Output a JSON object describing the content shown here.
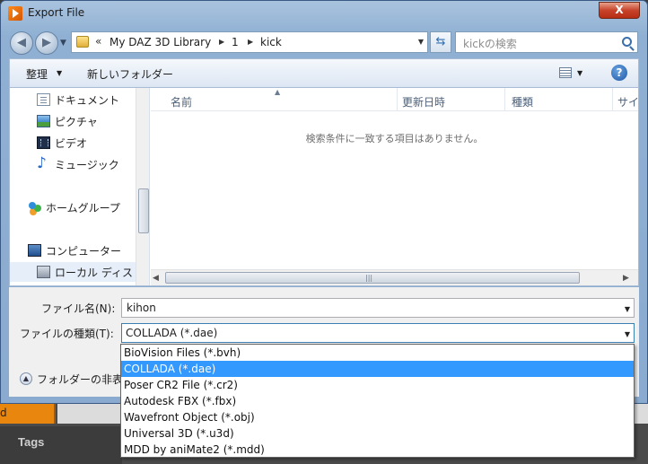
{
  "window": {
    "title": "Export File",
    "close_label": "X"
  },
  "address": {
    "chevrons": "«",
    "breadcrumbs": [
      "My DAZ 3D Library",
      "1",
      "kick"
    ]
  },
  "search": {
    "placeholder": "kickの検索"
  },
  "toolbar": {
    "organize": "整理",
    "new_folder": "新しいフォルダー"
  },
  "nav_pane": {
    "items": [
      {
        "label": "ドキュメント",
        "icon": "document-icon"
      },
      {
        "label": "ピクチャ",
        "icon": "pictures-icon"
      },
      {
        "label": "ビデオ",
        "icon": "video-icon"
      },
      {
        "label": "ミュージック",
        "icon": "music-icon"
      },
      {
        "label": "ホームグループ",
        "icon": "homegroup-icon"
      },
      {
        "label": "コンピューター",
        "icon": "computer-icon"
      },
      {
        "label": "ローカル ディス",
        "icon": "local-disk-icon"
      }
    ]
  },
  "file_list": {
    "columns": [
      "名前",
      "更新日時",
      "種類",
      "サイ"
    ],
    "empty_message": "検索条件に一致する項目はありません。"
  },
  "form": {
    "filename_label": "ファイル名(N):",
    "filename_value": "kihon",
    "filetype_label": "ファイルの種類(T):",
    "filetype_value": "COLLADA (*.dae)",
    "hide_folders_label": "フォルダーの非表"
  },
  "filetype_options": [
    "BioVision Files (*.bvh)",
    "COLLADA (*.dae)",
    "Poser CR2 File (*.cr2)",
    "Autodesk FBX (*.fbx)",
    "Wavefront Object (*.obj)",
    "Universal 3D (*.u3d)",
    "MDD by aniMate2 (*.mdd)"
  ],
  "filetype_selected_index": 1,
  "background_app": {
    "tab_label": "d",
    "tags_label": "Tags"
  },
  "colors": {
    "selection": "#3399ff",
    "accent_orange": "#e8860e"
  }
}
